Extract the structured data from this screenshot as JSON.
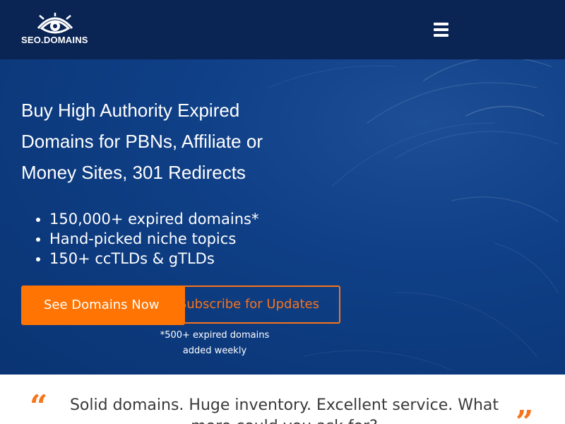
{
  "header": {
    "logo_text": "SEO.DOMAINS",
    "logo_icon": "eye-logo-icon",
    "menu_icon": "hamburger-menu-icon"
  },
  "hero": {
    "headline": "Buy High Authority Expired Domains for PBNs, Affiliate or Money Sites, 301 Redirects",
    "features": [
      "150,000+ expired domains*",
      "Hand-picked niche topics",
      "150+ ccTLDs & gTLDs"
    ],
    "primary_cta_label": "See Domains Now",
    "secondary_cta_label": "Subscribe for Updates",
    "note_line1": "*500+ expired domains",
    "note_line2": "added weekly"
  },
  "testimonial": {
    "text": "Solid domains. Huge inventory. Excellent service. What more could you ask for?",
    "open_quote": "“",
    "close_quote": "”"
  },
  "colors": {
    "header_bg": "#0a2454",
    "hero_bg": "#0f3f86",
    "accent_orange": "#ff7403",
    "text_white": "#ffffff"
  }
}
